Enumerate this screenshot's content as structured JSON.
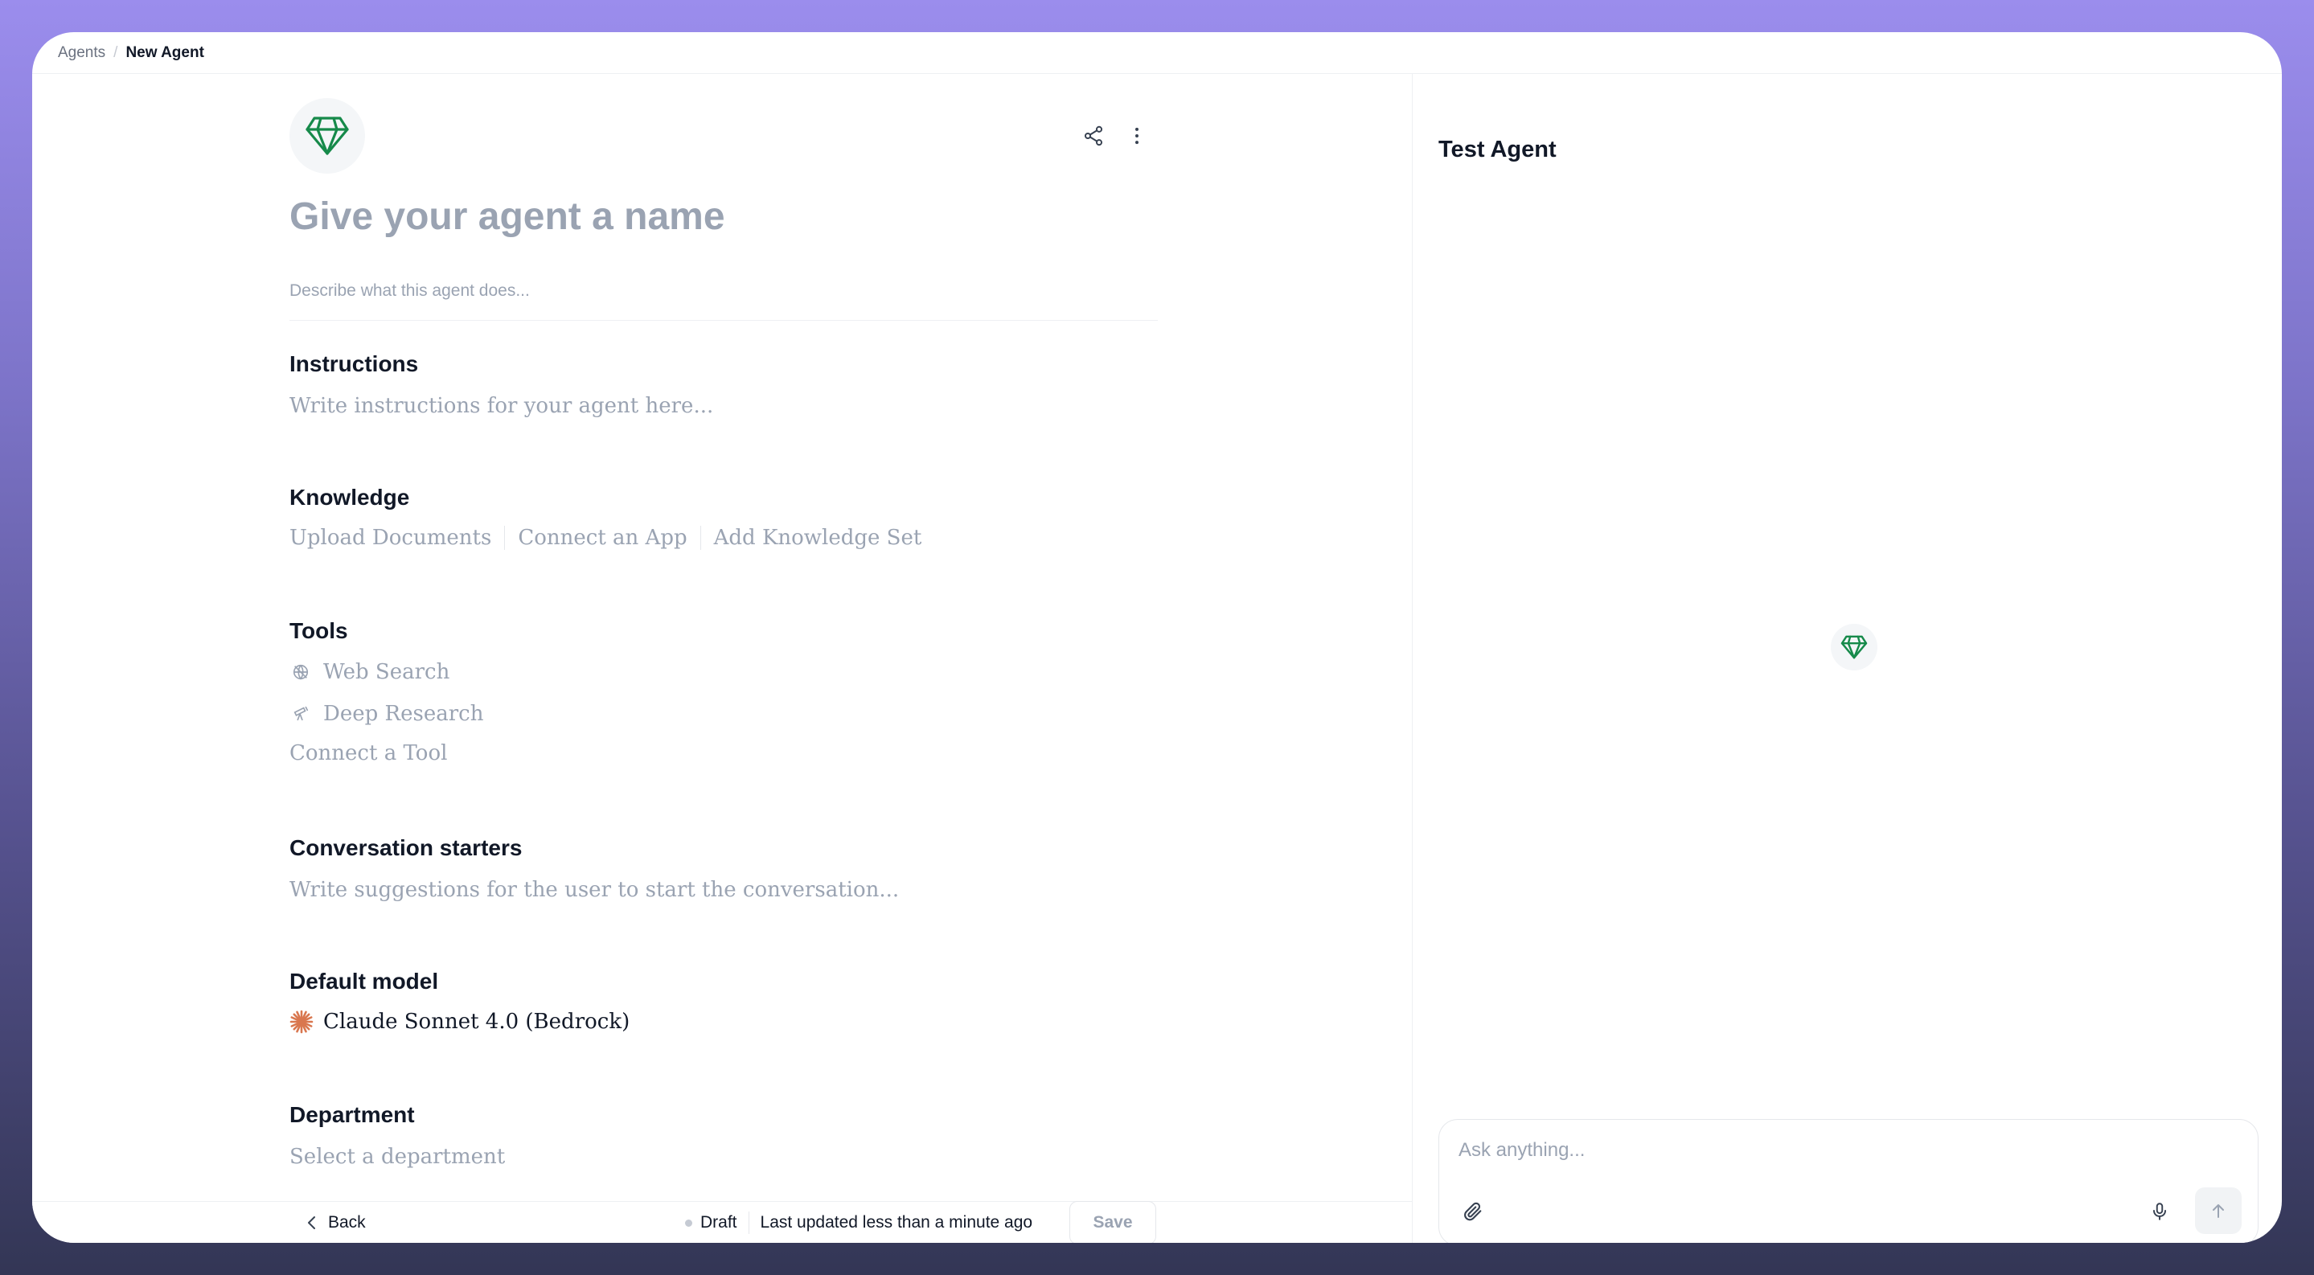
{
  "breadcrumb": {
    "parent": "Agents",
    "separator": "/",
    "current": "New Agent"
  },
  "agent": {
    "name_placeholder": "Give your agent a name",
    "description_placeholder": "Describe what this agent does..."
  },
  "header_icons": {
    "share": "share-icon",
    "more": "more-vertical-icon"
  },
  "sections": {
    "instructions": {
      "title": "Instructions",
      "placeholder": "Write instructions for your agent here..."
    },
    "knowledge": {
      "title": "Knowledge",
      "links": [
        "Upload Documents",
        "Connect an App",
        "Add Knowledge Set"
      ]
    },
    "tools": {
      "title": "Tools",
      "items": [
        {
          "label": "Web Search",
          "icon": "globe-icon"
        },
        {
          "label": "Deep Research",
          "icon": "telescope-icon"
        }
      ],
      "connect_label": "Connect a Tool"
    },
    "starters": {
      "title": "Conversation starters",
      "placeholder": "Write suggestions for the user to start the conversation..."
    },
    "model": {
      "title": "Default model",
      "value": "Claude Sonnet 4.0 (Bedrock)",
      "icon": "claude-icon"
    },
    "department": {
      "title": "Department",
      "placeholder": "Select a department"
    }
  },
  "footer": {
    "back_label": "Back",
    "status": "Draft",
    "updated": "Last updated less than a minute ago",
    "save_label": "Save"
  },
  "test_panel": {
    "title": "Test Agent",
    "input_placeholder": "Ask anything..."
  },
  "colors": {
    "accent_green": "#168a4a",
    "claude_orange": "#d9774f",
    "muted": "#9aa3b2",
    "text": "#111827"
  }
}
